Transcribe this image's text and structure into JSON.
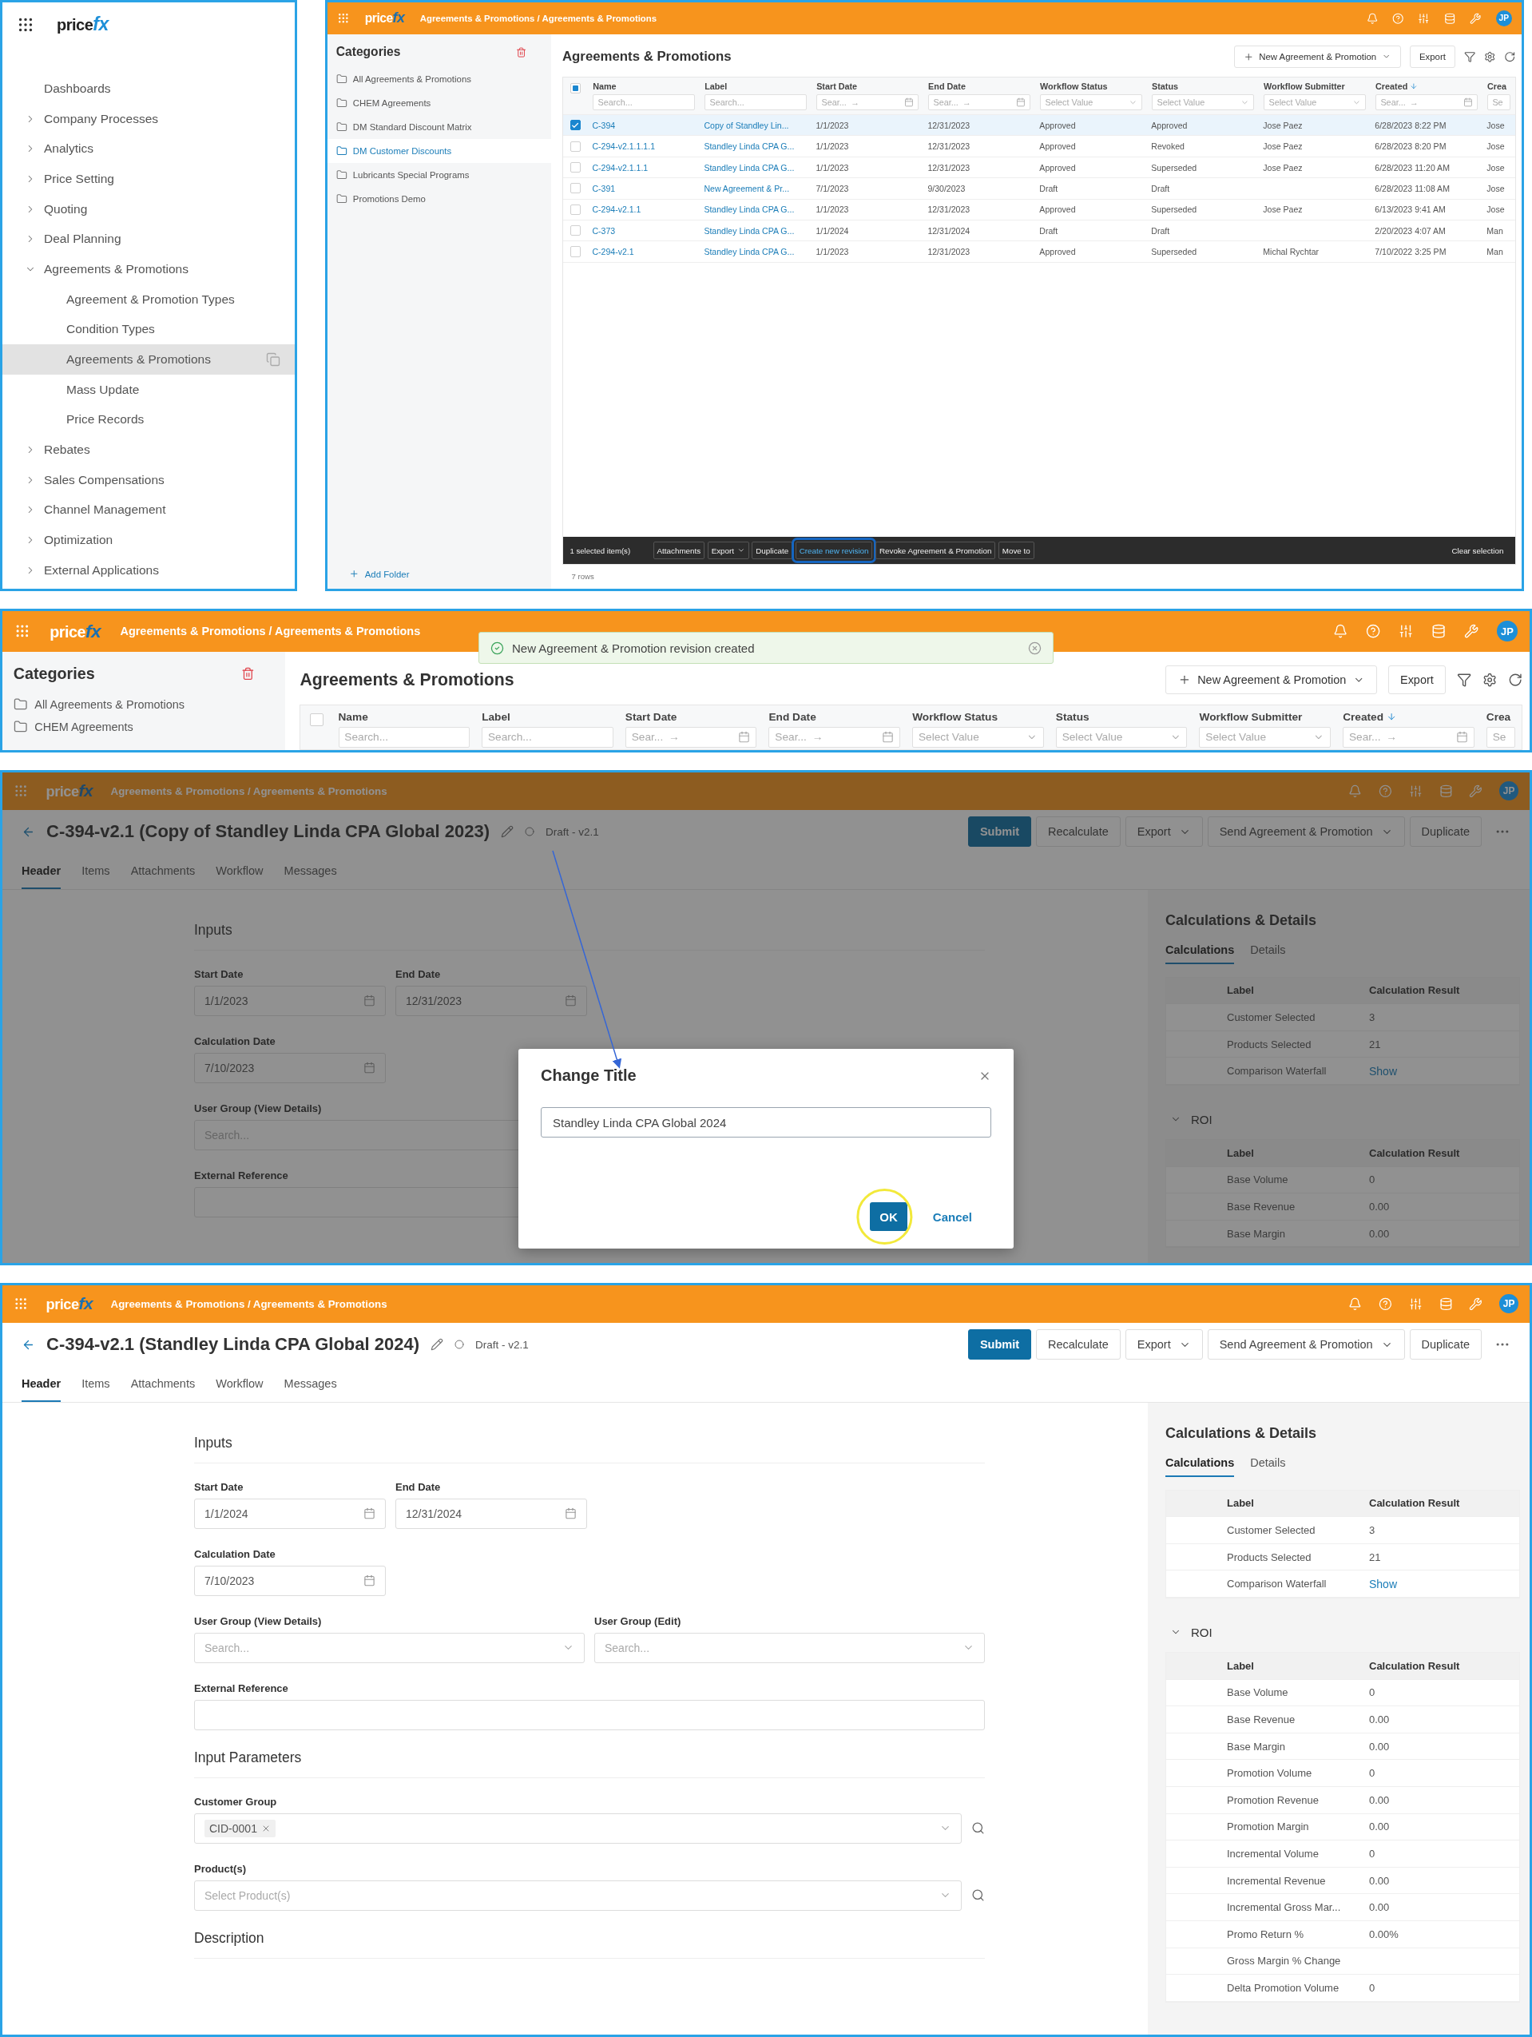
{
  "navigation": {
    "logo": {
      "text": "price",
      "accent": "fx"
    },
    "items": [
      {
        "label": "Dashboards",
        "kind": "link",
        "selected": false
      },
      {
        "label": "Company Processes",
        "kind": "group",
        "expanded": false
      },
      {
        "label": "Analytics",
        "kind": "group",
        "expanded": false
      },
      {
        "label": "Price Setting",
        "kind": "group",
        "expanded": false
      },
      {
        "label": "Quoting",
        "kind": "group",
        "expanded": false
      },
      {
        "label": "Deal Planning",
        "kind": "group",
        "expanded": false
      },
      {
        "label": "Agreements & Promotions",
        "kind": "group",
        "expanded": true,
        "children": [
          {
            "label": "Agreement & Promotion Types",
            "selected": false
          },
          {
            "label": "Condition Types",
            "selected": false
          },
          {
            "label": "Agreements & Promotions",
            "selected": true
          },
          {
            "label": "Mass Update",
            "selected": false
          },
          {
            "label": "Price Records",
            "selected": false
          }
        ]
      },
      {
        "label": "Rebates",
        "kind": "group",
        "expanded": false
      },
      {
        "label": "Sales Compensations",
        "kind": "group",
        "expanded": false
      },
      {
        "label": "Channel Management",
        "kind": "group",
        "expanded": false
      },
      {
        "label": "Optimization",
        "kind": "group",
        "expanded": false
      },
      {
        "label": "External Applications",
        "kind": "group",
        "expanded": false
      }
    ]
  },
  "list_screen": {
    "topbar": {
      "logo": {
        "text": "price",
        "accent": "fx"
      },
      "breadcrumb": "Agreements & Promotions / Agreements & Promotions",
      "avatar": "JP"
    },
    "categories": {
      "title": "Categories",
      "items": [
        {
          "label": "All Agreements & Promotions",
          "selected": false
        },
        {
          "label": "CHEM Agreements",
          "selected": false
        },
        {
          "label": "DM Standard Discount Matrix",
          "selected": false
        },
        {
          "label": "DM Customer Discounts",
          "selected": true
        },
        {
          "label": "Lubricants Special Programs",
          "selected": false
        },
        {
          "label": "Promotions Demo",
          "selected": false
        }
      ],
      "add_folder": "Add Folder"
    },
    "title": "Agreements & Promotions",
    "new_button": "New Agreement & Promotion",
    "export_button": "Export",
    "table": {
      "partial_selection": true,
      "columns": [
        {
          "label": "Name",
          "kind": "link",
          "sorted": false,
          "filter": {
            "kind": "text",
            "placeholder": "Search..."
          }
        },
        {
          "label": "Label",
          "kind": "link",
          "sorted": false,
          "filter": {
            "kind": "text",
            "placeholder": "Search..."
          }
        },
        {
          "label": "Start Date",
          "kind": "text",
          "sorted": false,
          "filter": {
            "kind": "date",
            "placeholder": "Sear...",
            "separator": "→"
          }
        },
        {
          "label": "End Date",
          "kind": "text",
          "sorted": false,
          "filter": {
            "kind": "date",
            "placeholder": "Sear...",
            "separator": "→"
          }
        },
        {
          "label": "Workflow Status",
          "kind": "text",
          "sorted": false,
          "filter": {
            "kind": "select",
            "placeholder": "Select Value"
          }
        },
        {
          "label": "Status",
          "kind": "text",
          "sorted": false,
          "filter": {
            "kind": "select",
            "placeholder": "Select Value"
          }
        },
        {
          "label": "Workflow Submitter",
          "kind": "text",
          "sorted": false,
          "filter": {
            "kind": "select",
            "placeholder": "Select Value"
          }
        },
        {
          "label": "Created",
          "kind": "text",
          "sorted": true,
          "filter": {
            "kind": "date",
            "placeholder": "Sear...",
            "separator": "→"
          }
        },
        {
          "label": "Crea",
          "kind": "text",
          "sorted": false,
          "filter": {
            "kind": "text",
            "placeholder": "Se"
          }
        }
      ],
      "rows": [
        {
          "selected": true,
          "cells": [
            "C-394",
            "Copy of Standley Lin...",
            "1/1/2023",
            "12/31/2023",
            "Approved",
            "Approved",
            "Jose Paez",
            "6/28/2023 8:22 PM",
            "Jose"
          ]
        },
        {
          "selected": false,
          "cells": [
            "C-294-v2.1.1.1.1",
            "Standley Linda CPA G...",
            "1/1/2023",
            "12/31/2023",
            "Approved",
            "Revoked",
            "Jose Paez",
            "6/28/2023 8:20 PM",
            "Jose"
          ]
        },
        {
          "selected": false,
          "cells": [
            "C-294-v2.1.1.1",
            "Standley Linda CPA G...",
            "1/1/2023",
            "12/31/2023",
            "Approved",
            "Superseded",
            "Jose Paez",
            "6/28/2023 11:20 AM",
            "Jose"
          ]
        },
        {
          "selected": false,
          "cells": [
            "C-391",
            "New Agreement & Pr...",
            "7/1/2023",
            "9/30/2023",
            "Draft",
            "Draft",
            null,
            "6/28/2023 11:08 AM",
            "Jose"
          ]
        },
        {
          "selected": false,
          "cells": [
            "C-294-v2.1.1",
            "Standley Linda CPA G...",
            "1/1/2023",
            "12/31/2023",
            "Approved",
            "Superseded",
            "Jose Paez",
            "6/13/2023 9:41 AM",
            "Jose"
          ]
        },
        {
          "selected": false,
          "cells": [
            "C-373",
            "Standley Linda CPA G...",
            "1/1/2024",
            "12/31/2024",
            "Draft",
            "Draft",
            null,
            "2/20/2023 4:07 AM",
            "Man"
          ]
        },
        {
          "selected": false,
          "cells": [
            "C-294-v2.1",
            "Standley Linda CPA G...",
            "1/1/2023",
            "12/31/2023",
            "Approved",
            "Superseded",
            "Michal Rychtar",
            "7/10/2022 3:25 PM",
            "Man"
          ]
        }
      ]
    },
    "selection_bar": {
      "count": "1 selected item(s)",
      "actions": [
        {
          "label": "Attachments",
          "dropdown": false,
          "highlighted": false
        },
        {
          "label": "Export",
          "dropdown": true,
          "highlighted": false
        },
        {
          "label": "Duplicate",
          "dropdown": false,
          "highlighted": false
        },
        {
          "label": "Create new revision",
          "dropdown": false,
          "highlighted": true
        },
        {
          "label": "Revoke Agreement & Promotion",
          "dropdown": false,
          "highlighted": false
        },
        {
          "label": "Move to",
          "dropdown": false,
          "highlighted": false
        }
      ],
      "clear": "Clear selection"
    },
    "row_count": "7 rows"
  },
  "toast_screen": {
    "topbar": {
      "logo": {
        "text": "price",
        "accent": "fx"
      },
      "breadcrumb": "Agreements & Promotions / Agreements & Promotions",
      "avatar": "JP"
    },
    "toast": {
      "message": "New Agreement & Promotion revision created"
    },
    "categories": {
      "title": "Categories",
      "items": [
        {
          "label": "All Agreements & Promotions",
          "selected": false
        },
        {
          "label": "CHEM Agreements",
          "selected": false
        }
      ]
    },
    "title": "Agreements & Promotions",
    "new_button": "New Agreement & Promotion",
    "export_button": "Export",
    "table": {
      "partial_selection": false,
      "columns": [
        {
          "label": "Name",
          "sorted": false,
          "filter": {
            "kind": "text",
            "placeholder": "Search..."
          }
        },
        {
          "label": "Label",
          "sorted": false,
          "filter": {
            "kind": "text",
            "placeholder": "Search..."
          }
        },
        {
          "label": "Start Date",
          "sorted": false,
          "filter": {
            "kind": "date",
            "placeholder": "Sear...",
            "separator": "→"
          }
        },
        {
          "label": "End Date",
          "sorted": false,
          "filter": {
            "kind": "date",
            "placeholder": "Sear...",
            "separator": "→"
          }
        },
        {
          "label": "Workflow Status",
          "sorted": false,
          "filter": {
            "kind": "select",
            "placeholder": "Select Value"
          }
        },
        {
          "label": "Status",
          "sorted": false,
          "filter": {
            "kind": "select",
            "placeholder": "Select Value"
          }
        },
        {
          "label": "Workflow Submitter",
          "sorted": false,
          "filter": {
            "kind": "select",
            "placeholder": "Select Value"
          }
        },
        {
          "label": "Created",
          "sorted": true,
          "filter": {
            "kind": "date",
            "placeholder": "Sear...",
            "separator": "→"
          }
        },
        {
          "label": "Crea",
          "sorted": false,
          "filter": {
            "kind": "text",
            "placeholder": "Se"
          }
        }
      ]
    }
  },
  "dialog_screen": {
    "topbar": {
      "logo": {
        "text": "price",
        "accent": "fx"
      },
      "breadcrumb": "Agreements & Promotions / Agreements & Promotions",
      "avatar": "JP"
    },
    "detail": {
      "title": "C-394-v2.1 (Copy of Standley Linda CPA Global 2023)",
      "status": "Draft - v2.1",
      "actions": [
        {
          "label": "Submit",
          "kind": "primary"
        },
        {
          "label": "Recalculate",
          "kind": "plain"
        },
        {
          "label": "Export",
          "kind": "dropdown"
        },
        {
          "label": "Send Agreement & Promotion",
          "kind": "dropdown"
        },
        {
          "label": "Duplicate",
          "kind": "plain"
        }
      ],
      "tabs": [
        {
          "label": "Header",
          "selected": true
        },
        {
          "label": "Items",
          "selected": false
        },
        {
          "label": "Attachments",
          "selected": false
        },
        {
          "label": "Workflow",
          "selected": false
        },
        {
          "label": "Messages",
          "selected": false
        }
      ],
      "sections": [
        {
          "title": "Inputs",
          "rows": [
            [
              {
                "label": "Start Date",
                "kind": "date",
                "value": "1/1/2023"
              },
              {
                "label": "End Date",
                "kind": "date",
                "value": "12/31/2023"
              }
            ],
            [
              {
                "label": "Calculation Date",
                "kind": "date",
                "value": "7/10/2023"
              }
            ],
            [
              {
                "label": "User Group (View Details)",
                "kind": "select",
                "placeholder": "Search...",
                "lookup": false
              }
            ],
            [
              {
                "label": "External Reference",
                "kind": "text"
              }
            ]
          ]
        }
      ],
      "side": {
        "title": "Calculations & Details",
        "tabs": [
          {
            "label": "Calculations",
            "selected": true
          },
          {
            "label": "Details",
            "selected": false
          }
        ],
        "columns": [
          "Label",
          "Calculation Result"
        ],
        "rows": [
          {
            "label": "Customer Selected",
            "result": "3",
            "kind": "text"
          },
          {
            "label": "Products Selected",
            "result": "21",
            "kind": "text"
          },
          {
            "label": "Comparison Waterfall",
            "result": "Show",
            "kind": "link"
          }
        ],
        "sections": [
          {
            "title": "ROI",
            "expanded": true,
            "columns": [
              "Label",
              "Calculation Result"
            ],
            "rows": [
              {
                "label": "Base Volume",
                "result": "0",
                "kind": "text"
              },
              {
                "label": "Base Revenue",
                "result": "0.00",
                "kind": "text"
              },
              {
                "label": "Base Margin",
                "result": "0.00",
                "kind": "text"
              }
            ]
          }
        ]
      }
    },
    "modal": {
      "title": "Change Title",
      "value": "Standley Linda CPA Global 2024",
      "ok": "OK",
      "cancel": "Cancel"
    }
  },
  "detail_screen": {
    "topbar": {
      "logo": {
        "text": "price",
        "accent": "fx"
      },
      "breadcrumb": "Agreements & Promotions / Agreements & Promotions",
      "avatar": "JP"
    },
    "detail": {
      "title": "C-394-v2.1 (Standley Linda CPA Global 2024)",
      "status": "Draft - v2.1",
      "actions": [
        {
          "label": "Submit",
          "kind": "primary"
        },
        {
          "label": "Recalculate",
          "kind": "plain"
        },
        {
          "label": "Export",
          "kind": "dropdown"
        },
        {
          "label": "Send Agreement & Promotion",
          "kind": "dropdown"
        },
        {
          "label": "Duplicate",
          "kind": "plain"
        }
      ],
      "tabs": [
        {
          "label": "Header",
          "selected": true
        },
        {
          "label": "Items",
          "selected": false
        },
        {
          "label": "Attachments",
          "selected": false
        },
        {
          "label": "Workflow",
          "selected": false
        },
        {
          "label": "Messages",
          "selected": false
        }
      ],
      "sections": [
        {
          "title": "Inputs",
          "rows": [
            [
              {
                "label": "Start Date",
                "kind": "date",
                "value": "1/1/2024"
              },
              {
                "label": "End Date",
                "kind": "date",
                "value": "12/31/2024"
              }
            ],
            [
              {
                "label": "Calculation Date",
                "kind": "date",
                "value": "7/10/2023"
              }
            ],
            [
              {
                "label": "User Group (View Details)",
                "kind": "select",
                "placeholder": "Search...",
                "lookup": false
              },
              {
                "label": "User Group (Edit)",
                "kind": "select",
                "placeholder": "Search...",
                "lookup": false
              }
            ],
            [
              {
                "label": "External Reference",
                "kind": "text"
              }
            ]
          ]
        },
        {
          "title": "Input Parameters",
          "rows": [
            [
              {
                "label": "Customer Group",
                "kind": "tags",
                "tags": [
                  "CID-0001"
                ],
                "lookup": true
              }
            ],
            [
              {
                "label": "Product(s)",
                "kind": "select",
                "placeholder": "Select Product(s)",
                "lookup": true
              }
            ]
          ]
        },
        {
          "title": "Description"
        }
      ],
      "side": {
        "title": "Calculations & Details",
        "tabs": [
          {
            "label": "Calculations",
            "selected": true
          },
          {
            "label": "Details",
            "selected": false
          }
        ],
        "columns": [
          "Label",
          "Calculation Result"
        ],
        "rows": [
          {
            "label": "Customer Selected",
            "result": "3",
            "kind": "text"
          },
          {
            "label": "Products Selected",
            "result": "21",
            "kind": "text"
          },
          {
            "label": "Comparison Waterfall",
            "result": "Show",
            "kind": "link"
          }
        ],
        "sections": [
          {
            "title": "ROI",
            "expanded": true,
            "columns": [
              "Label",
              "Calculation Result"
            ],
            "rows": [
              {
                "label": "Base Volume",
                "result": "0",
                "kind": "text"
              },
              {
                "label": "Base Revenue",
                "result": "0.00",
                "kind": "text"
              },
              {
                "label": "Base Margin",
                "result": "0.00",
                "kind": "text"
              },
              {
                "label": "Promotion Volume",
                "result": "0",
                "kind": "text"
              },
              {
                "label": "Promotion Revenue",
                "result": "0.00",
                "kind": "text"
              },
              {
                "label": "Promotion Margin",
                "result": "0.00",
                "kind": "text"
              },
              {
                "label": "Incremental Volume",
                "result": "0",
                "kind": "text"
              },
              {
                "label": "Incremental Revenue",
                "result": "0.00",
                "kind": "text"
              },
              {
                "label": "Incremental Gross Mar...",
                "result": "0.00",
                "kind": "text"
              },
              {
                "label": "Promo Return %",
                "result": "0.00%",
                "kind": "text"
              },
              {
                "label": "Gross Margin % Change"
              },
              {
                "label": "Delta Promotion Volume",
                "result": "0",
                "kind": "text"
              }
            ]
          }
        ]
      }
    }
  }
}
